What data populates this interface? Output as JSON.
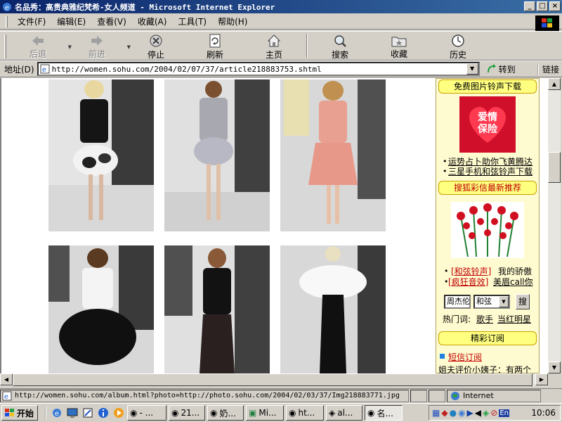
{
  "window": {
    "title": "名品秀：高贵典雅纪梵希-女人频道 - Microsoft Internet Explorer",
    "controls": [
      "_",
      "□",
      "×"
    ]
  },
  "menu": [
    "文件(F)",
    "编辑(E)",
    "查看(V)",
    "收藏(A)",
    "工具(T)",
    "帮助(H)"
  ],
  "toolbar": {
    "back": "后退",
    "forward": "前进",
    "stop": "停止",
    "refresh": "刷新",
    "home": "主页",
    "search": "搜索",
    "favorites": "收藏",
    "history": "历史"
  },
  "address": {
    "label": "地址(D)",
    "url": "http://women.sohu.com/2004/02/07/37/article218883753.shtml",
    "go": "转到",
    "links": "链接"
  },
  "sidebar": {
    "head1": "免费图片铃声下载",
    "promo_text": "爱情\n保险",
    "link1": "运势占卜助你飞黄腾达",
    "link2": "三星手机和弦铃声下载",
    "head2": "搜狐彩信最新推荐",
    "line1_tag": "[和弦铃声]",
    "line1_text": "我的骄傲",
    "line2_tag": "[疯狂音效]",
    "line2_text": "美眉call你",
    "search_value": "周杰伦",
    "select_value": "和弦",
    "search_button": "搜",
    "hot_label": "热门词:",
    "hot1": "歌手",
    "hot2": "当红明星",
    "head3": "精彩订阅",
    "sub_link": "短信订阅",
    "sub_text": "姐夫评价小姨子：有两个"
  },
  "status": {
    "text": "http://women.sohu.com/album.html?photo=http://photo.sohu.com/2004/02/03/37/Img218883771.jpg",
    "zone": "Internet"
  },
  "taskbar": {
    "start": "开始",
    "tasks": [
      "- ...",
      "21...",
      "奶...",
      "Mi...",
      "ht...",
      "al...",
      "名..."
    ],
    "clock": "10:06"
  },
  "colors": {
    "titlebar_start": "#0a246a",
    "titlebar_end": "#3a6ea5",
    "sidebar_head": "#ffff80",
    "sidebar_box": "#fffbd0",
    "promo_red": "#d0102a",
    "link_red": "#c00000"
  }
}
